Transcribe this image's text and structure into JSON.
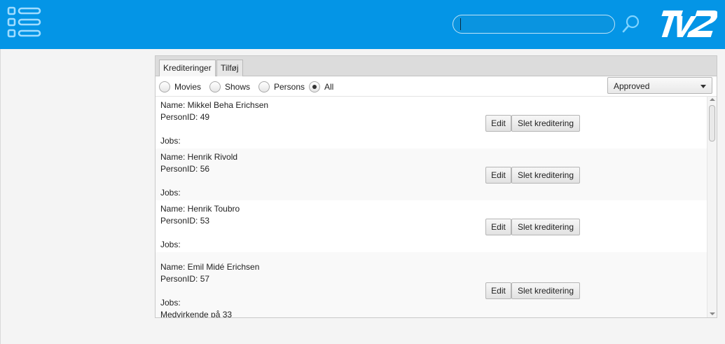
{
  "header": {
    "menu_icon": "menu-list-icon",
    "search": {
      "value": "",
      "placeholder": ""
    },
    "search_icon": "search-icon",
    "logo_text": "TV2",
    "brand_color": "#0495e6"
  },
  "tabs": [
    {
      "label": "Krediteringer",
      "active": true
    },
    {
      "label": "Tilføj",
      "active": false
    }
  ],
  "filters": {
    "options": [
      "Movies",
      "Shows",
      "Persons",
      "All"
    ],
    "selected": "All",
    "status_select": {
      "value": "Approved"
    }
  },
  "credits": [
    {
      "name": "Name: Mikkel Beha Erichsen",
      "person_id": "PersonID: 49",
      "jobs_label": "Jobs:",
      "jobs": [],
      "edit_label": "Edit",
      "delete_label": "Slet kreditering"
    },
    {
      "name": "Name: Henrik Rivold",
      "person_id": "PersonID: 56",
      "jobs_label": "Jobs:",
      "jobs": [],
      "edit_label": "Edit",
      "delete_label": "Slet kreditering"
    },
    {
      "name": "Name: Henrik Toubro",
      "person_id": "PersonID: 53",
      "jobs_label": "Jobs:",
      "jobs": [],
      "edit_label": "Edit",
      "delete_label": "Slet kreditering"
    },
    {
      "name": "Name: Emil Midé Erichsen",
      "person_id": "PersonID: 57",
      "jobs_label": "Jobs:",
      "jobs": [
        "Medvirkende på 33"
      ],
      "edit_label": "Edit",
      "delete_label": "Slet kreditering"
    }
  ]
}
